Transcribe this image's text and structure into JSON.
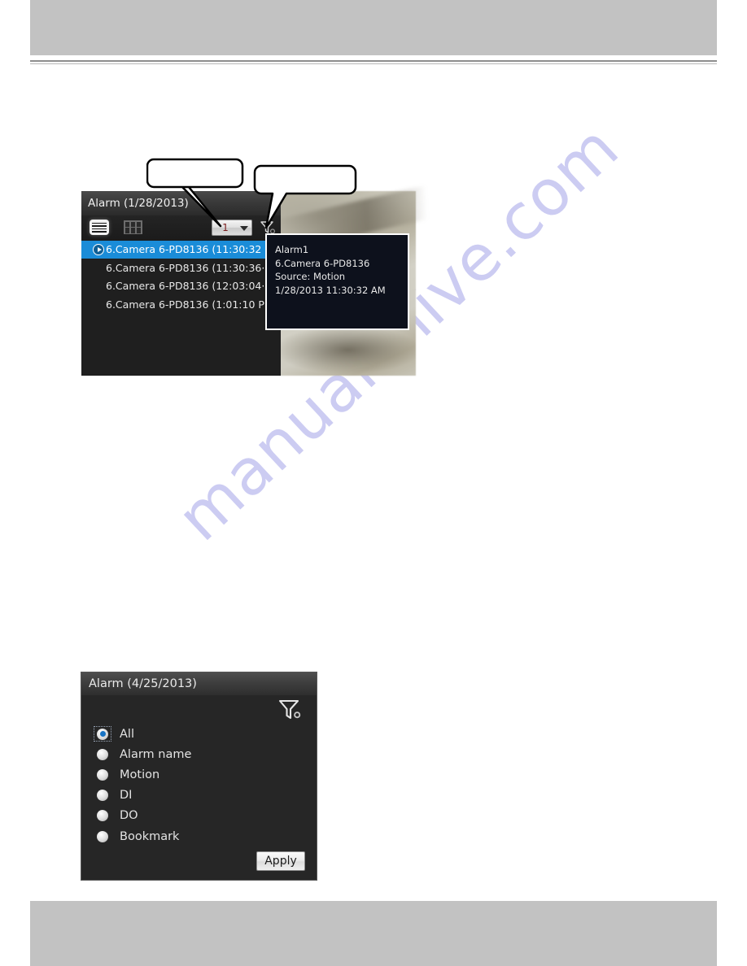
{
  "page": {
    "watermark_text": "manualshive.com",
    "watermark_color": "#ccccf2",
    "header_band_color": "#c2c2c2",
    "footer_band_color": "#c2c2c2"
  },
  "figure1": {
    "title": "Alarm (1/28/2013)",
    "toolbar": {
      "list_view_icon": "list-view-icon",
      "grid_view_icon": "grid-view-icon",
      "page_select_value": "1",
      "page_select_options": [
        "1"
      ],
      "filter_icon": "filter-funnel-icon"
    },
    "callouts": [
      {
        "label": "",
        "name": "callout-balloon-page-select"
      },
      {
        "label": "",
        "name": "callout-balloon-filter"
      }
    ],
    "alarm_rows": [
      {
        "text": "6.Camera 6-PD8136 (11:30:32",
        "selected": true
      },
      {
        "text": "6.Camera 6-PD8136 (11:30:36···",
        "selected": false
      },
      {
        "text": "6.Camera 6-PD8136 (12:03:04···",
        "selected": false
      },
      {
        "text": "6.Camera 6-PD8136 (1:01:10 P··",
        "selected": false
      }
    ],
    "tooltip": {
      "line1": "Alarm1",
      "line2": "6.Camera 6-PD8136",
      "line3": "Source: Motion",
      "line4": "1/28/2013 11:30:32 AM"
    },
    "colors": {
      "selected_row": "#1a8cd8",
      "panel_bg": "#1f1f1f",
      "tooltip_bg": "#0d111c",
      "select_value_text": "#7a1c1c"
    }
  },
  "figure2": {
    "title": "Alarm (4/25/2013)",
    "filter_icon": "filter-funnel-settings-icon",
    "options": [
      {
        "label": "All",
        "checked": true
      },
      {
        "label": "Alarm name",
        "checked": false
      },
      {
        "label": "Motion",
        "checked": false
      },
      {
        "label": "DI",
        "checked": false
      },
      {
        "label": "DO",
        "checked": false
      },
      {
        "label": "Bookmark",
        "checked": false
      }
    ],
    "apply_label": "Apply",
    "colors": {
      "panel_bg": "#262626",
      "radio_selected": "#1773c4"
    }
  }
}
